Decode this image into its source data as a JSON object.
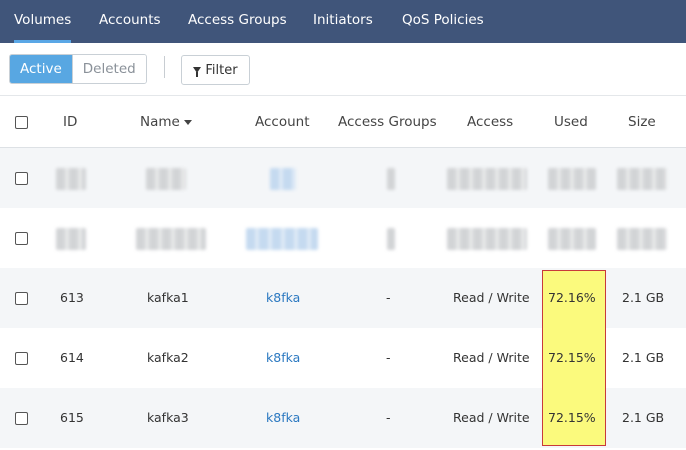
{
  "tabs": [
    {
      "label": "Volumes",
      "active": true
    },
    {
      "label": "Accounts",
      "active": false
    },
    {
      "label": "Access Groups",
      "active": false
    },
    {
      "label": "Initiators",
      "active": false
    },
    {
      "label": "QoS Policies",
      "active": false
    }
  ],
  "toolbar": {
    "active_label": "Active",
    "deleted_label": "Deleted",
    "filter_label": "Filter"
  },
  "columns": {
    "id": "ID",
    "name": "Name",
    "account": "Account",
    "access_groups": "Access Groups",
    "access": "Access",
    "used": "Used",
    "size": "Size"
  },
  "rows": [
    {
      "id": "613",
      "name": "kafka1",
      "account": "k8fka",
      "access_groups": "-",
      "access": "Read / Write",
      "used": "72.16%",
      "size": "2.1 GB"
    },
    {
      "id": "614",
      "name": "kafka2",
      "account": "k8fka",
      "access_groups": "-",
      "access": "Read / Write",
      "used": "72.15%",
      "size": "2.1 GB"
    },
    {
      "id": "615",
      "name": "kafka3",
      "account": "k8fka",
      "access_groups": "-",
      "access": "Read / Write",
      "used": "72.15%",
      "size": "2.1 GB"
    }
  ],
  "colors": {
    "tab_bar": "#40557a",
    "active_tab_underline": "#5aa7e6",
    "active_button": "#58a7e2",
    "link": "#2c79c1",
    "highlight_fill": "#fbfa7d",
    "highlight_border": "#c83a3a"
  },
  "icons": {
    "filter": "funnel-icon",
    "sort": "caret-down-icon"
  }
}
